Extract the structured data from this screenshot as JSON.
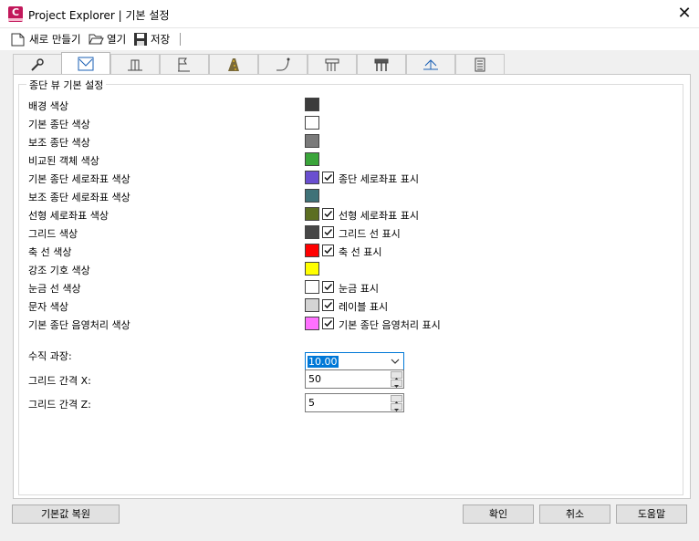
{
  "window": {
    "title": "Project Explorer | 기본 설정",
    "icon_letter": "C",
    "close_glyph": "✕"
  },
  "toolbar": {
    "new_label": "새로 만들기",
    "open_label": "열기",
    "save_label": "저장"
  },
  "tabs": [
    {
      "icon": "wrench-icon"
    },
    {
      "icon": "profile-view-icon",
      "active": true
    },
    {
      "icon": "cross-section-icon"
    },
    {
      "icon": "sheet-flag-icon"
    },
    {
      "icon": "corridor-road-icon"
    },
    {
      "icon": "alignment-curve-icon"
    },
    {
      "icon": "pipe-network-icon"
    },
    {
      "icon": "pressure-network-icon"
    },
    {
      "icon": "surface-icon"
    },
    {
      "icon": "report-table-icon"
    }
  ],
  "group": {
    "title": "종단 뷰 기본 설정",
    "rows": [
      {
        "label": "배경 색상",
        "color": "#3c3c3c"
      },
      {
        "label": "기본 종단 색상",
        "color": "#ffffff"
      },
      {
        "label": "보조 종단 색상",
        "color": "#7a7a7a"
      },
      {
        "label": "비교된 객체 색상",
        "color": "#3aa53a"
      },
      {
        "label": "기본 종단 세로좌표 색상",
        "color": "#6a4fd0",
        "checkbox": {
          "label": "종단 세로좌표 표시",
          "checked": true
        }
      },
      {
        "label": "보조 종단 세로좌표 색상",
        "color": "#3f7278"
      },
      {
        "label": "선형 세로좌표 색상",
        "color": "#5c6e22",
        "checkbox": {
          "label": "선형 세로좌표 표시",
          "checked": true
        }
      },
      {
        "label": "그리드 색상",
        "color": "#474747",
        "checkbox": {
          "label": "그리드 선 표시",
          "checked": true
        }
      },
      {
        "label": "축 선 색상",
        "color": "#ff0000",
        "checkbox": {
          "label": "축 선 표시",
          "checked": true
        }
      },
      {
        "label": "강조 기호 색상",
        "color": "#ffff00"
      },
      {
        "label": "눈금 선 색상",
        "color": "#ffffff",
        "checkbox": {
          "label": "눈금 표시",
          "checked": true
        }
      },
      {
        "label": "문자 색상",
        "color": "#d4d4d4",
        "checkbox": {
          "label": "레이블 표시",
          "checked": true
        }
      },
      {
        "label": "기본 종단 음영처리 색상",
        "color": "#ff70ff",
        "checkbox": {
          "label": "기본 종단 음영처리 표시",
          "checked": true
        }
      }
    ],
    "vertical_exaggeration": {
      "label": "수직 과장:",
      "value": "10.00"
    },
    "grid_x": {
      "label": "그리드 간격 X:",
      "value": "50"
    },
    "grid_z": {
      "label": "그리드 간격 Z:",
      "value": "5"
    }
  },
  "buttons": {
    "restore_defaults": "기본값 복원",
    "ok": "확인",
    "cancel": "취소",
    "help": "도움말"
  },
  "colors": {
    "accent": "#0078d7",
    "app_icon": "#c2185b"
  }
}
